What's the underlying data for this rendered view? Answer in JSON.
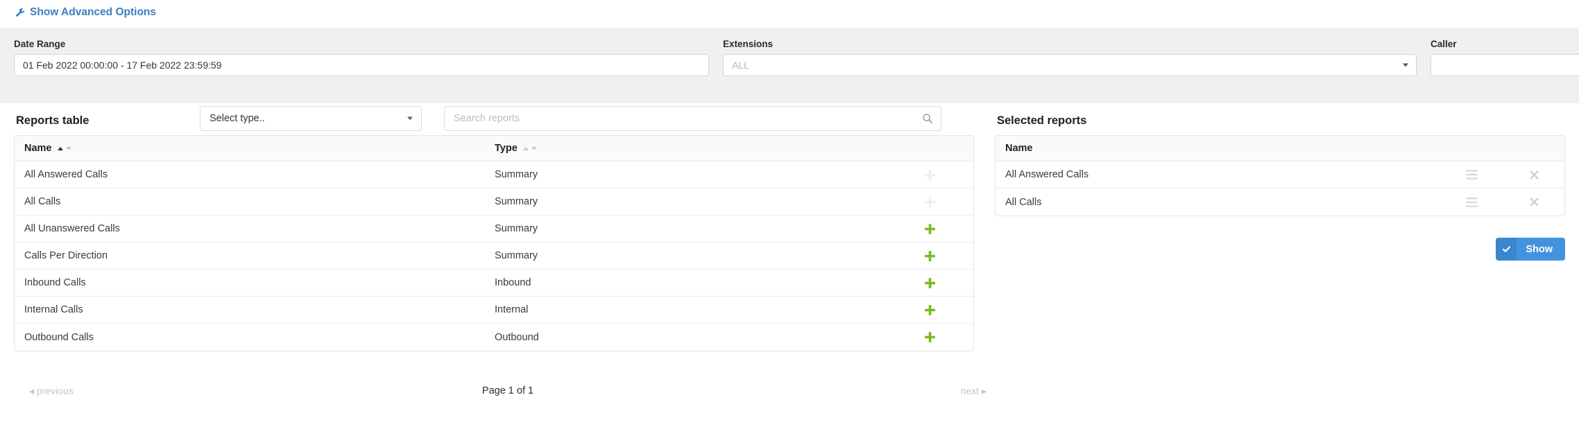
{
  "advanced": {
    "label": "Show Advanced Options",
    "icon": "wrench-icon",
    "color": "#3a7fc1"
  },
  "filters": {
    "date_range": {
      "label": "Date Range",
      "value": "01 Feb 2022 00:00:00 - 17 Feb 2022 23:59:59"
    },
    "extensions": {
      "label": "Extensions",
      "placeholder": "ALL",
      "value": ""
    },
    "caller": {
      "label": "Caller",
      "placeholder": "",
      "value": ""
    }
  },
  "reports_panel": {
    "title": "Reports table",
    "type_filter": {
      "label": "Select type..",
      "icon": "chevron-down-icon"
    },
    "search": {
      "placeholder": "Search reports",
      "value": "",
      "icon": "search-icon"
    },
    "columns": [
      "Name",
      "Type"
    ],
    "sort": {
      "column": "Name",
      "direction": "asc"
    },
    "rows": [
      {
        "name": "All Answered Calls",
        "type": "Summary",
        "action": "add",
        "added": true
      },
      {
        "name": "All Calls",
        "type": "Summary",
        "action": "add",
        "added": true
      },
      {
        "name": "All Unanswered Calls",
        "type": "Summary",
        "action": "add",
        "added": false
      },
      {
        "name": "Calls Per Direction",
        "type": "Summary",
        "action": "add",
        "added": false
      },
      {
        "name": "Inbound Calls",
        "type": "Inbound",
        "action": "add",
        "added": false
      },
      {
        "name": "Internal Calls",
        "type": "Internal",
        "action": "add",
        "added": false
      },
      {
        "name": "Outbound Calls",
        "type": "Outbound",
        "action": "add",
        "added": false
      }
    ],
    "pagination": {
      "previous": "previous",
      "page_info": "Page 1 of 1",
      "next": "next"
    }
  },
  "selected_panel": {
    "title": "Selected reports",
    "columns": [
      "Name"
    ],
    "rows": [
      {
        "name": "All Answered Calls"
      },
      {
        "name": "All Calls"
      }
    ],
    "show_button": {
      "label": "Show",
      "icon": "check-icon",
      "color": "#4293dd"
    }
  },
  "colors": {
    "accent_blue": "#3a7fc1",
    "add_green": "#76bc21",
    "add_green_disabled": "#eeeeee",
    "band_gray": "#f0f0f0",
    "header_gray": "#f9fafb"
  }
}
